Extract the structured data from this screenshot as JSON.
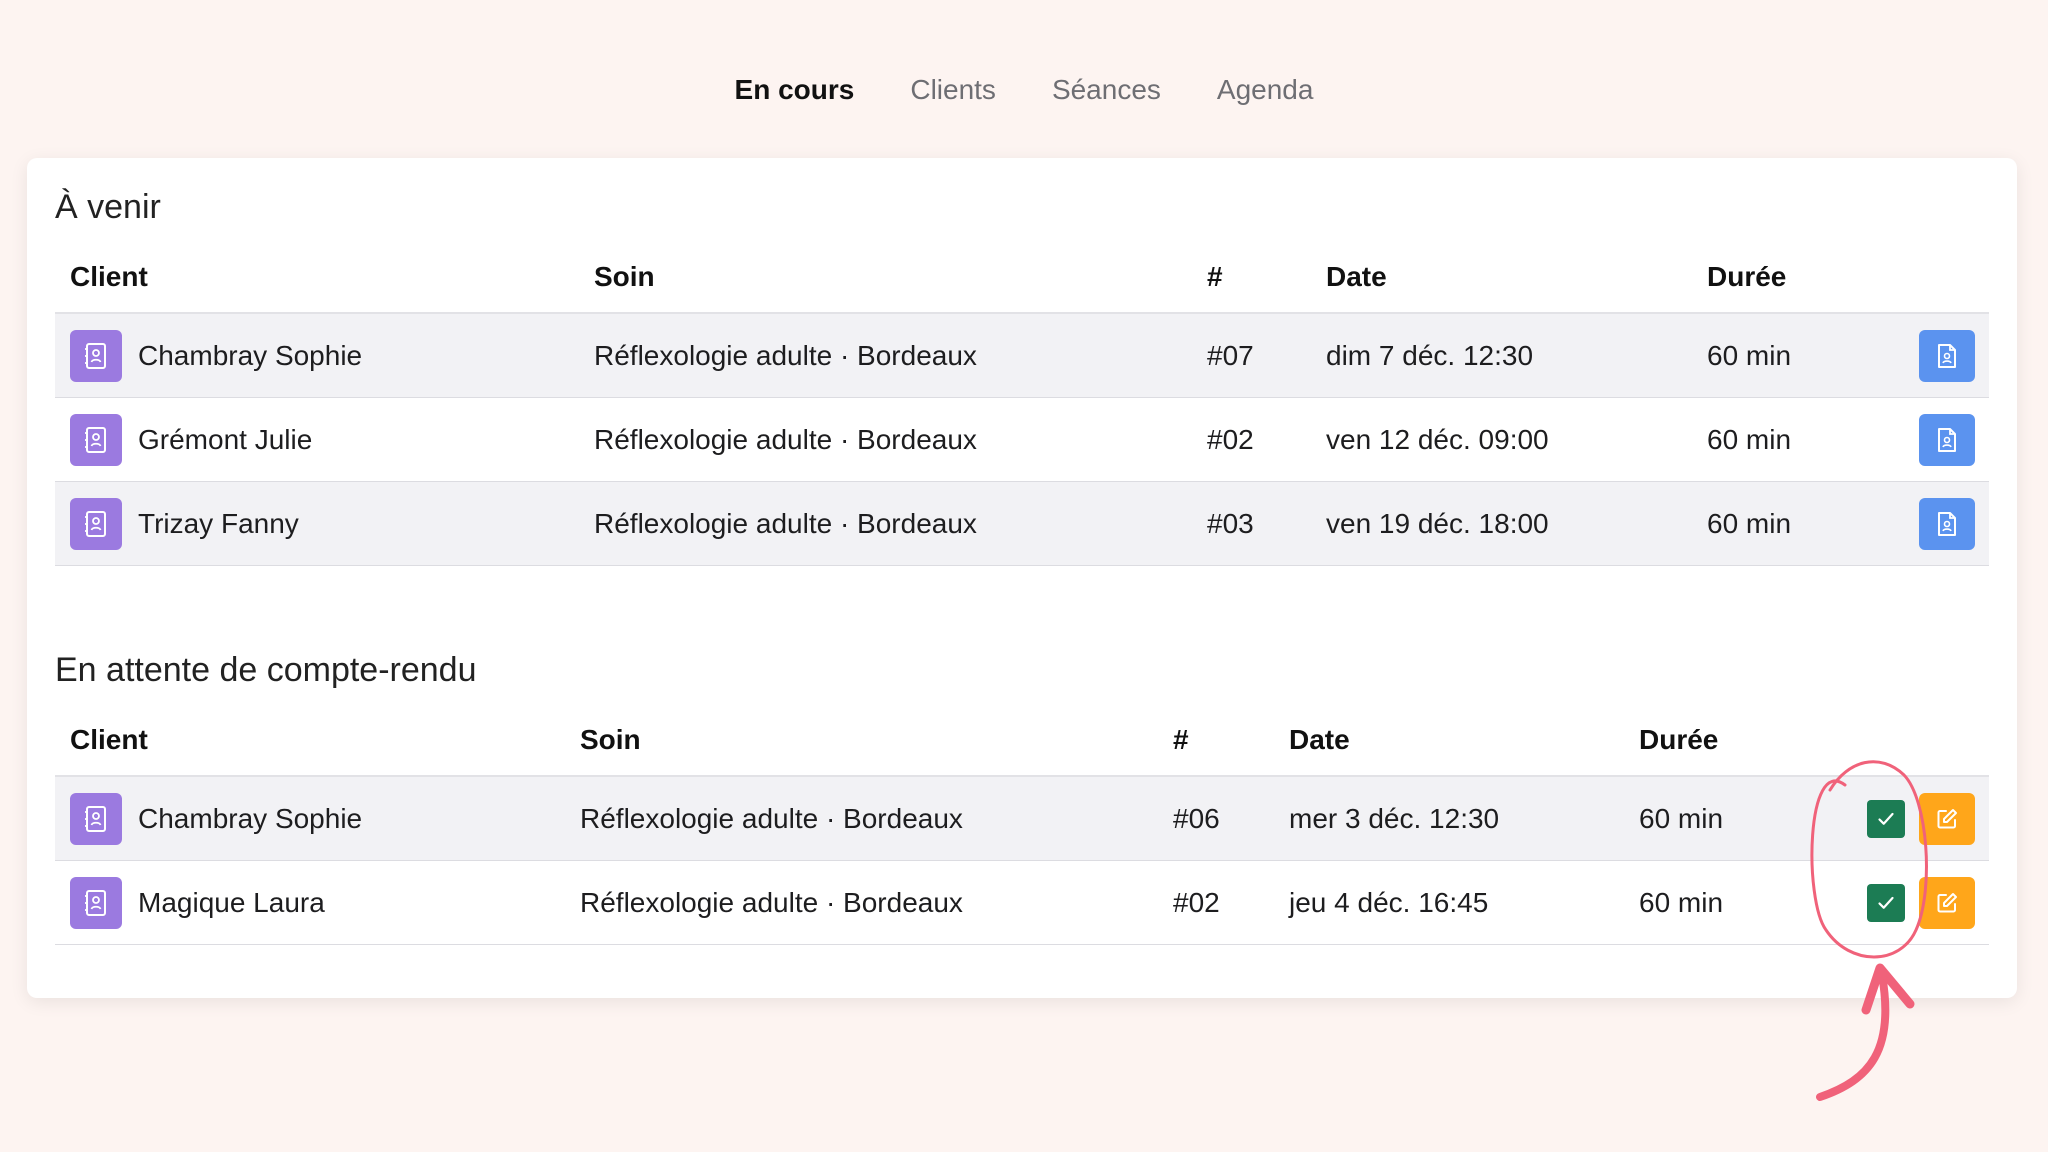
{
  "nav": {
    "tabs": [
      {
        "label": "En cours",
        "active": true
      },
      {
        "label": "Clients",
        "active": false
      },
      {
        "label": "Séances",
        "active": false
      },
      {
        "label": "Agenda",
        "active": false
      }
    ]
  },
  "upcoming": {
    "title": "À venir",
    "headers": {
      "client": "Client",
      "soin": "Soin",
      "num": "#",
      "date": "Date",
      "duree": "Durée"
    },
    "rows": [
      {
        "client": "Chambray Sophie",
        "soin": "Réflexologie adulte · Bordeaux",
        "num": "#07",
        "date": "dim 7 déc. 12:30",
        "duree": "60 min"
      },
      {
        "client": "Grémont Julie",
        "soin": "Réflexologie adulte · Bordeaux",
        "num": "#02",
        "date": "ven 12 déc. 09:00",
        "duree": "60 min"
      },
      {
        "client": "Trizay Fanny",
        "soin": "Réflexologie adulte · Bordeaux",
        "num": "#03",
        "date": "ven 19 déc. 18:00",
        "duree": "60 min"
      }
    ]
  },
  "pending": {
    "title": "En attente de compte-rendu",
    "headers": {
      "client": "Client",
      "soin": "Soin",
      "num": "#",
      "date": "Date",
      "duree": "Durée"
    },
    "rows": [
      {
        "client": "Chambray Sophie",
        "soin": "Réflexologie adulte · Bordeaux",
        "num": "#06",
        "date": "mer 3 déc. 12:30",
        "duree": "60 min"
      },
      {
        "client": "Magique Laura",
        "soin": "Réflexologie adulte · Bordeaux",
        "num": "#02",
        "date": "jeu 4 déc. 16:45",
        "duree": "60 min"
      }
    ]
  },
  "icons": {
    "contact": "contact-card-icon",
    "document": "document-icon",
    "check": "check-icon",
    "edit": "edit-icon"
  },
  "colors": {
    "background": "#fdf4f1",
    "contact_button": "#9b7ae0",
    "document_button": "#5b93ef",
    "check_button": "#1c7c54",
    "edit_button": "#ffa61a",
    "annotation": "#f0627a"
  }
}
